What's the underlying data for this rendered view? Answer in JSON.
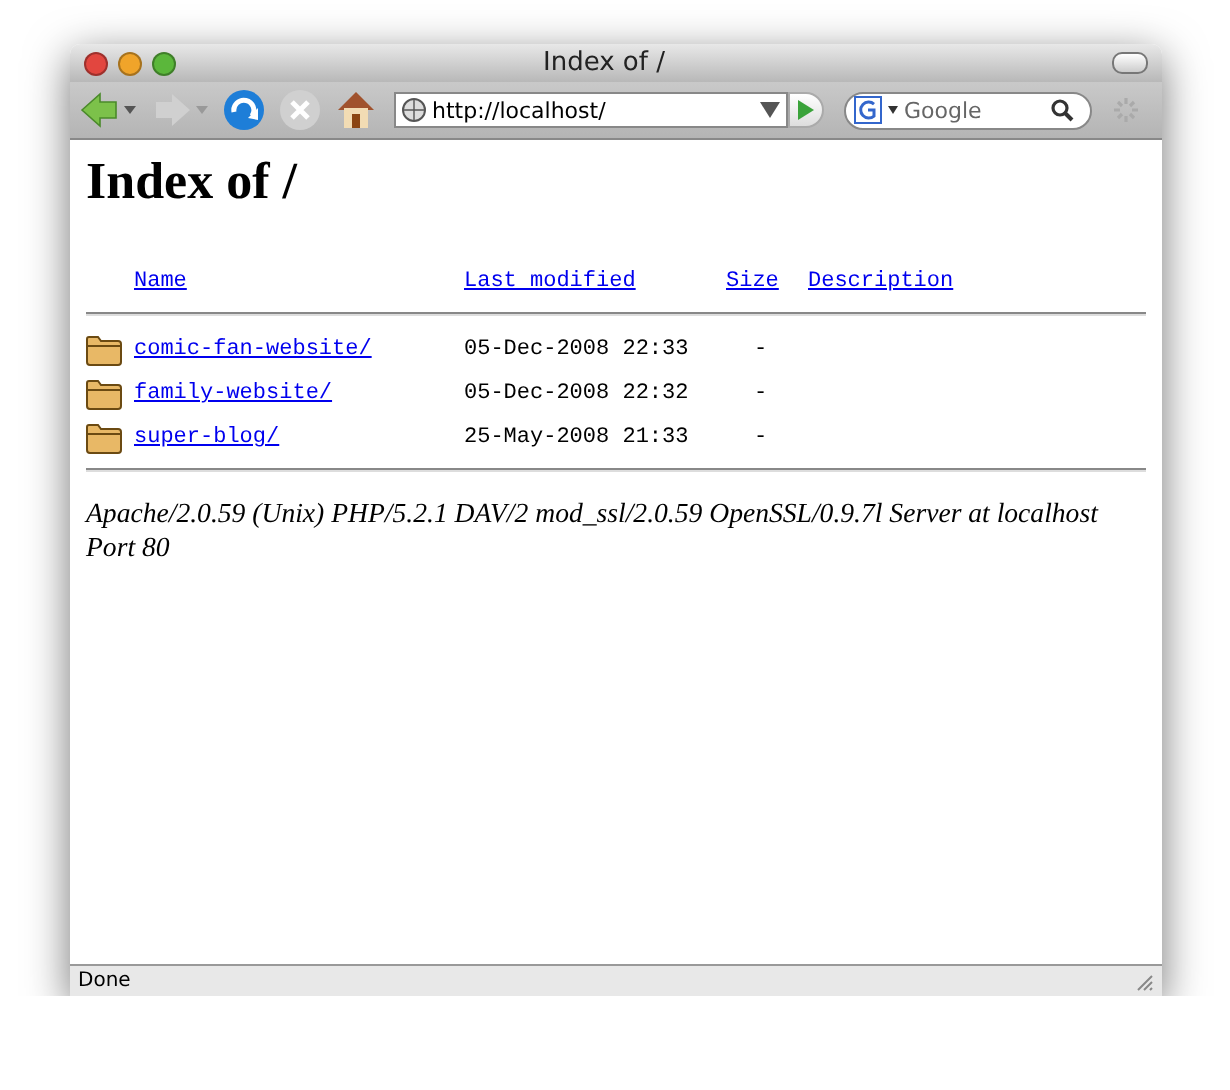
{
  "window": {
    "title": "Index of /"
  },
  "nav_buttons": [
    {
      "kind": "back",
      "disabled": false
    },
    {
      "kind": "forward",
      "disabled": true
    },
    {
      "kind": "reload",
      "disabled": false
    },
    {
      "kind": "stop",
      "disabled": true
    },
    {
      "kind": "home",
      "disabled": false
    }
  ],
  "address_bar": {
    "value": "http://localhost/"
  },
  "search": {
    "placeholder": "Google"
  },
  "page": {
    "heading": "Index of /",
    "columns": [
      "Name",
      "Last modified",
      "Size",
      "Description"
    ],
    "rows": [
      {
        "name": "comic-fan-website/",
        "modified": "05-Dec-2008 22:33",
        "size": "-"
      },
      {
        "name": "family-website/",
        "modified": "05-Dec-2008 22:32",
        "size": "-"
      },
      {
        "name": "super-blog/",
        "modified": "25-May-2008 21:33",
        "size": "-"
      }
    ],
    "signature": "Apache/2.0.59 (Unix) PHP/5.2.1 DAV/2 mod_ssl/2.0.59 OpenSSL/0.9.7l Server at localhost Port 80"
  },
  "status_bar": {
    "text": "Done"
  }
}
